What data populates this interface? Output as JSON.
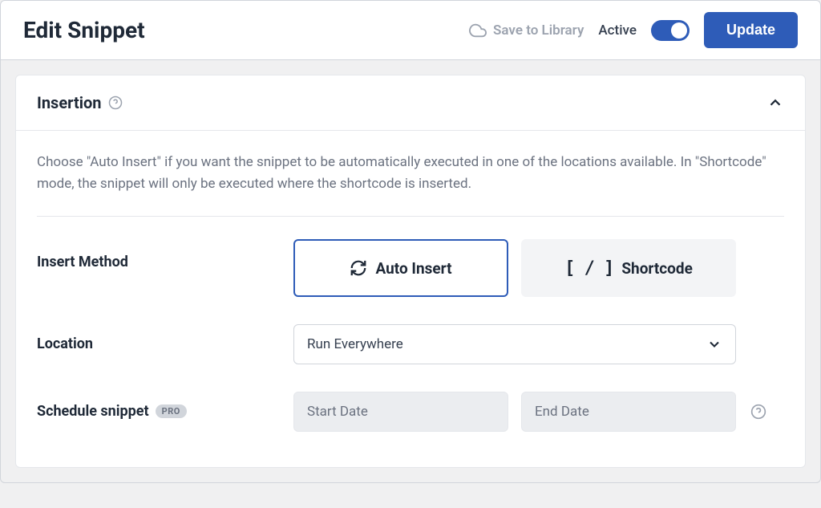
{
  "header": {
    "title": "Edit Snippet",
    "save_library_label": "Save to Library",
    "active_label": "Active",
    "update_label": "Update"
  },
  "panel": {
    "title": "Insertion",
    "description": "Choose \"Auto Insert\" if you want the snippet to be automatically executed in one of the locations available. In \"Shortcode\" mode, the snippet will only be executed where the shortcode is inserted."
  },
  "insert_method": {
    "label": "Insert Method",
    "auto_insert_label": "Auto Insert",
    "shortcode_label": "Shortcode"
  },
  "location": {
    "label": "Location",
    "selected": "Run Everywhere"
  },
  "schedule": {
    "label": "Schedule snippet",
    "badge": "PRO",
    "start_placeholder": "Start Date",
    "end_placeholder": "End Date"
  }
}
